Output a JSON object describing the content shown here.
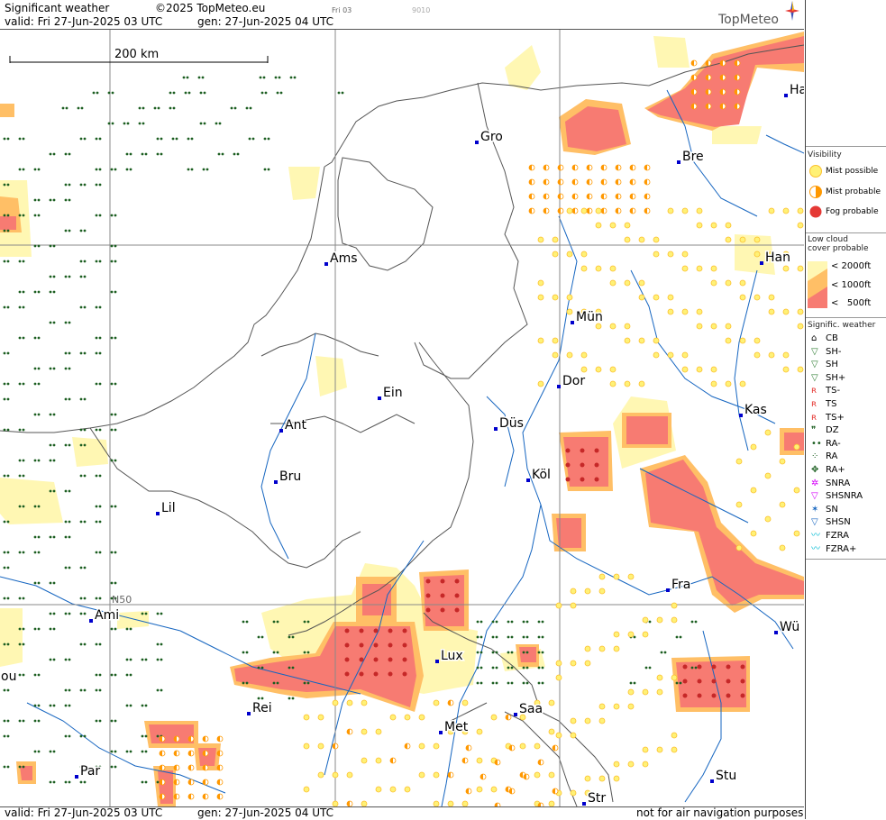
{
  "header": {
    "title": "Significant weather",
    "copyright": "©2025 TopMeteo.eu",
    "tag1": "Fri 03",
    "tag2": "9010",
    "valid": "valid:  Fri   27-Jun-2025  03 UTC",
    "gen": "gen: 27-Jun-2025 04 UTC",
    "logo": "TopMeteo"
  },
  "scale_label": "200 km",
  "lat_label": "N50",
  "cities": [
    {
      "name": "Gro"
    },
    {
      "name": "Bre"
    },
    {
      "name": "Ha"
    },
    {
      "name": "Ams"
    },
    {
      "name": "Han"
    },
    {
      "name": "Mün"
    },
    {
      "name": "Ein"
    },
    {
      "name": "Dor"
    },
    {
      "name": "Kas"
    },
    {
      "name": "Ant"
    },
    {
      "name": "Düs"
    },
    {
      "name": "Bru"
    },
    {
      "name": "Köl"
    },
    {
      "name": "Lil"
    },
    {
      "name": "Fra"
    },
    {
      "name": "Ami"
    },
    {
      "name": "Wü"
    },
    {
      "name": "Lux"
    },
    {
      "name": "Rei"
    },
    {
      "name": "Saa"
    },
    {
      "name": "Met"
    },
    {
      "name": "Par"
    },
    {
      "name": "Stu"
    },
    {
      "name": "Str"
    },
    {
      "name": "ou"
    }
  ],
  "legend": {
    "visibility_title": "Visibility",
    "visibility": [
      {
        "label": "Mist possible",
        "color": "#fff176"
      },
      {
        "label": "Mist probable",
        "color": "#ff9800"
      },
      {
        "label": "Fog probable",
        "color": "#e53935"
      }
    ],
    "lowcloud_title": "Low cloud cover probable",
    "lowcloud": [
      {
        "label": "< 2000ft",
        "color": "#fff7b3"
      },
      {
        "label": "< 1000ft",
        "color": "#ffbf66"
      },
      {
        "label": "<   500ft",
        "color": "#f77b72"
      }
    ],
    "sigwx_title": "Signific. weather",
    "sigwx": [
      {
        "label": "CB",
        "icon": "cb-icon"
      },
      {
        "label": "SH-",
        "icon": "shower-light-icon"
      },
      {
        "label": "SH",
        "icon": "shower-icon"
      },
      {
        "label": "SH+",
        "icon": "shower-heavy-icon"
      },
      {
        "label": "TS-",
        "icon": "thunder-light-icon"
      },
      {
        "label": "TS",
        "icon": "thunder-icon"
      },
      {
        "label": "TS+",
        "icon": "thunder-heavy-icon"
      },
      {
        "label": "DZ",
        "icon": "drizzle-icon"
      },
      {
        "label": "RA-",
        "icon": "rain-light-icon"
      },
      {
        "label": "RA",
        "icon": "rain-icon"
      },
      {
        "label": "RA+",
        "icon": "rain-heavy-icon"
      },
      {
        "label": "SNRA",
        "icon": "snow-rain-icon"
      },
      {
        "label": "SHSNRA",
        "icon": "shower-snow-rain-icon"
      },
      {
        "label": "SN",
        "icon": "snow-icon"
      },
      {
        "label": "SHSN",
        "icon": "shower-snow-icon"
      },
      {
        "label": "FZRA",
        "icon": "freezing-rain-icon"
      },
      {
        "label": "FZRA+",
        "icon": "freezing-rain-heavy-icon"
      }
    ]
  },
  "footer": {
    "valid": "valid:  Fri   27-Jun-2025  03 UTC",
    "gen": "gen: 27-Jun-2025 04 UTC",
    "note": "not for air navigation purposes"
  }
}
